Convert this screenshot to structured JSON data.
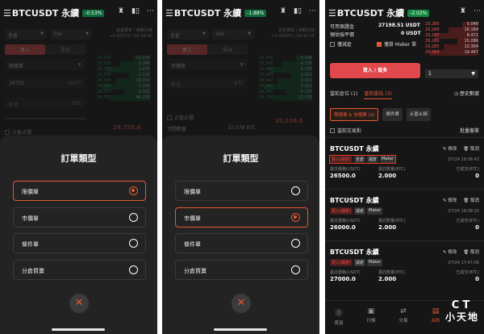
{
  "symbol": "BTCUSDT 永續",
  "phone1": {
    "change": "-0.53%",
    "margin_mode": "全倉",
    "leverage": "20x",
    "funding": "資金費率 / 倒數計時",
    "funding_val": "+0.0052% / 06:39:46",
    "buy": "買入",
    "sell": "賣出",
    "order_type": "限價單",
    "price": "29752",
    "price_unit": "USDT",
    "qty_placeholder": "數量",
    "qty_unit": "BTC",
    "tpsl": "止盈止損",
    "last_price": "29,750.0"
  },
  "phone2": {
    "change": "-1.88%",
    "margin_mode": "全倉",
    "leverage": "20x",
    "funding": "資金費率 / 倒數計時",
    "funding_val": "+0.0043% / 05:42:16",
    "buy": "買入",
    "sell": "賣出",
    "order_type": "市價單",
    "qty_placeholder": "數量",
    "qty_unit": "BTC",
    "tpsl": "止盈止損",
    "last_price": "29,338.8",
    "avail_label": "可開數量",
    "avail_val": "23.578 BTC"
  },
  "orderbook": {
    "asks": [
      [
        "29,759",
        "13.224"
      ],
      [
        "29,758",
        "6.096"
      ],
      [
        "29,757",
        "2.070"
      ],
      [
        "29,756",
        "2.119"
      ],
      [
        "29,755",
        "19.350"
      ],
      [
        "29,754",
        "5.349"
      ],
      [
        "29,753",
        "3.393"
      ],
      [
        "29,752",
        "44.226"
      ]
    ],
    "asks2": [
      [
        "29,346",
        "9.598"
      ],
      [
        "29,345",
        "4.356"
      ],
      [
        "29,344",
        "8.198"
      ],
      [
        "29,343",
        "0.552"
      ],
      [
        "29,342",
        "3.022"
      ],
      [
        "29,341",
        "3.022"
      ],
      [
        "29,340",
        "6.100"
      ],
      [
        "29,339",
        "23.578"
      ]
    ]
  },
  "sheet": {
    "title": "訂單類型",
    "options": [
      "限價單",
      "市價單",
      "條件單",
      "分倉買賣"
    ]
  },
  "phone3": {
    "change": "-2.02%",
    "avail_label": "可用保證金",
    "avail_val": "27198.51 USDT",
    "maint_label": "預估強平價",
    "maint_val": "0 USDT",
    "reduce_only": "僅減倉",
    "maker_only": "僅掛 Maker 單",
    "big_button": "買入 / 做多",
    "qty": "1",
    "tabs": [
      "當前倉位 (1)",
      "當前委託 (3)"
    ],
    "history": "歷史數據",
    "pills": [
      "限價單 & 市價單 (3)",
      "條件單",
      "止盈止損"
    ],
    "other_orders": "當前交易對",
    "cancel_all": "批量撤單",
    "edit": "修改",
    "cancel": "取消",
    "tags": [
      "買入(開倉)",
      "全倉",
      "減倉",
      "Maker"
    ],
    "lbl_price": "委託價格(USDT)",
    "lbl_qty": "委託數量(BTC)",
    "lbl_filled": "已成交(BTC)",
    "orders": [
      {
        "time": "07/24 18:08:43",
        "price": "26500.0",
        "qty": "2.000",
        "filled": "0"
      },
      {
        "time": "07/24 18:08:20",
        "price": "26000.0",
        "qty": "2.000",
        "filled": "0"
      },
      {
        "time": "07/24 17:47:06",
        "price": "27000.0",
        "qty": "2.000",
        "filled": "0"
      }
    ],
    "book": [
      [
        "29,289",
        "5.048"
      ],
      [
        "29,288",
        "16.184"
      ],
      [
        "29,287",
        "8.472"
      ],
      [
        "29,286",
        "15.086"
      ],
      [
        "29,285",
        "10.364"
      ],
      [
        "29,284",
        "19.447"
      ]
    ],
    "nav": [
      "首頁",
      "行情",
      "交易",
      "合約"
    ],
    "watermark": [
      "CT",
      "小天地"
    ]
  }
}
